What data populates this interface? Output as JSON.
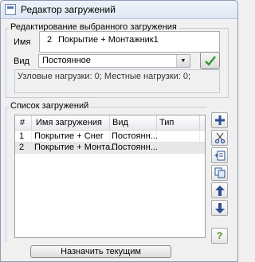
{
  "window": {
    "title": "Редактор загружений"
  },
  "edit_group": {
    "legend": "Редактирование выбранного загружения",
    "name_label": "Имя",
    "name_number": "2",
    "name_value": "Покрытие + Монтажник1",
    "type_label": "Вид",
    "type_value": "Постоянное",
    "info_text": "Узловые нагрузки:  0;   Местные нагрузки:  0;"
  },
  "list_group": {
    "legend": "Список загружений",
    "columns": [
      "#",
      "Имя загружения",
      "Вид",
      "Тип"
    ],
    "rows": [
      {
        "num": "1",
        "name": "Покрытие + Снег",
        "kind": "Постоянн...",
        "type": ""
      },
      {
        "num": "2",
        "name": "Покрытие + Монта...",
        "kind": "Постоянн...",
        "type": ""
      }
    ]
  },
  "buttons": {
    "assign_current": "Назначить текущим",
    "help": "?"
  },
  "icons": {
    "add": "plus-icon",
    "cut": "scissors-icon",
    "insert": "insert-icon",
    "copy": "copy-icon",
    "up": "arrow-up-icon",
    "down": "arrow-down-icon",
    "apply": "checkmark-icon"
  }
}
